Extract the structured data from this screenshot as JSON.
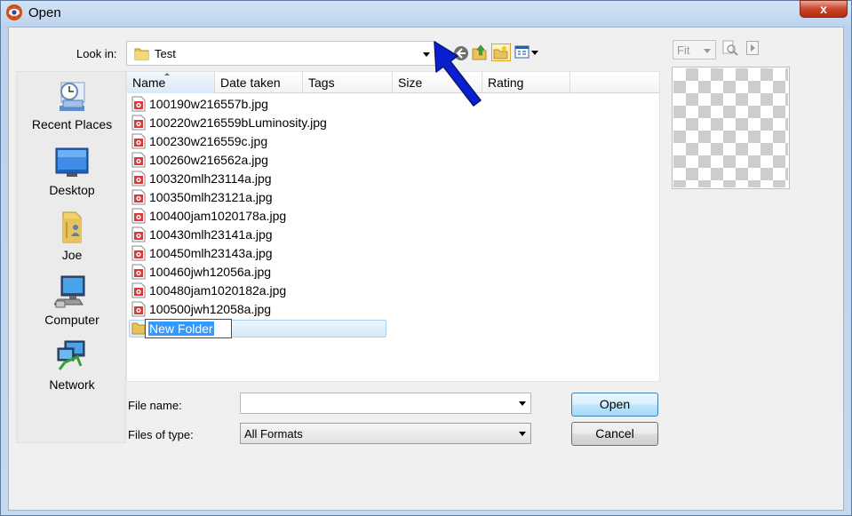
{
  "window": {
    "title": "Open",
    "close_label": "x"
  },
  "lookin": {
    "label": "Look in:",
    "value": "Test"
  },
  "places": [
    {
      "label": "Recent Places",
      "icon": "recent-places-icon"
    },
    {
      "label": "Desktop",
      "icon": "desktop-icon"
    },
    {
      "label": "Joe",
      "icon": "user-folder-icon"
    },
    {
      "label": "Computer",
      "icon": "computer-icon"
    },
    {
      "label": "Network",
      "icon": "network-icon"
    }
  ],
  "columns": [
    "Name",
    "Date taken",
    "Tags",
    "Size",
    "Rating"
  ],
  "files": [
    "100190w216557b.jpg",
    "100220w216559bLuminosity.jpg",
    "100230w216559c.jpg",
    "100260w216562a.jpg",
    "100320mlh23114a.jpg",
    "100350mlh23121a.jpg",
    "100400jam1020178a.jpg",
    "100430mlh23141a.jpg",
    "100450mlh23143a.jpg",
    "100460jwh12056a.jpg",
    "100480jam1020182a.jpg",
    "100500jwh12058a.jpg"
  ],
  "new_folder": {
    "name": "New Folder"
  },
  "bottom": {
    "file_name_label": "File name:",
    "file_name_value": "",
    "file_type_label": "Files of type:",
    "file_type_value": "All Formats",
    "open_label": "Open",
    "cancel_label": "Cancel"
  },
  "preview": {
    "fit_value": "Fit"
  },
  "colors": {
    "annotation_arrow": "#0a1fd0",
    "selection": "#3399ff"
  }
}
